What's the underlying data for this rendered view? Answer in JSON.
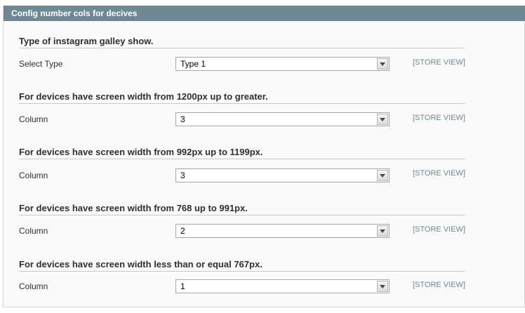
{
  "panel": {
    "title": "Config number cols for decives"
  },
  "sections": [
    {
      "heading": "Type of instagram galley show.",
      "label": "Select Type",
      "value": "Type 1",
      "scope": "[STORE VIEW]"
    },
    {
      "heading": "For devices have screen width from 1200px up to greater.",
      "label": "Column",
      "value": "3",
      "scope": "[STORE VIEW]"
    },
    {
      "heading": "For devices have screen width from 992px up to 1199px.",
      "label": "Column",
      "value": "3",
      "scope": "[STORE VIEW]"
    },
    {
      "heading": "For devices have screen width from 768 up to 991px.",
      "label": "Column",
      "value": "2",
      "scope": "[STORE VIEW]"
    },
    {
      "heading": "For devices have screen width less than or equal 767px.",
      "label": "Column",
      "value": "1",
      "scope": "[STORE VIEW]"
    }
  ]
}
